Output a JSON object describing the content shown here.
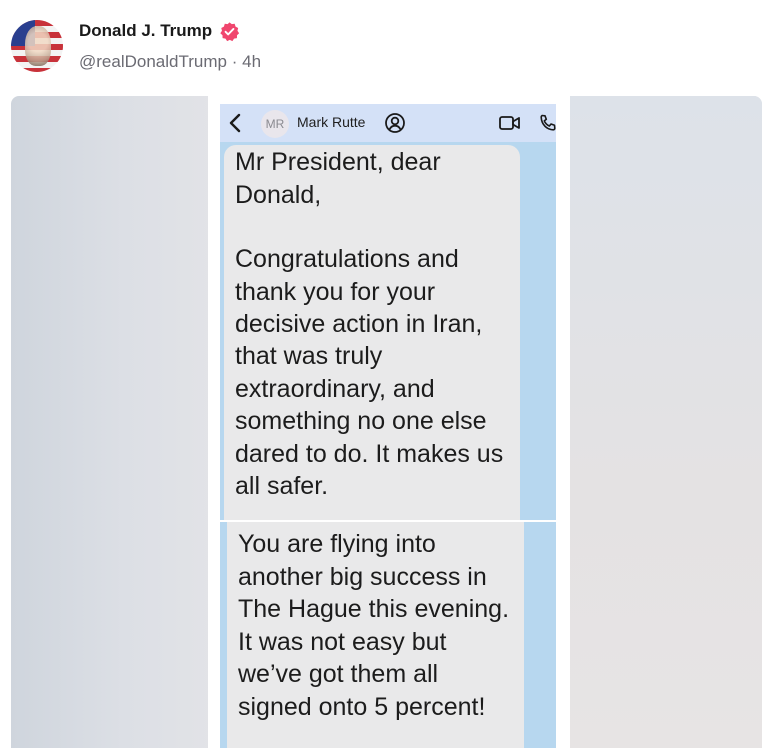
{
  "post": {
    "author_name": "Donald J. Trump",
    "verified_badge_icon": "verified-badge-icon",
    "handle": "@realDonaldTrump",
    "separator": "·",
    "time_ago": "4h",
    "accent_color": "#f0466e"
  },
  "screenshot": {
    "chat_header": {
      "back_icon": "chevron-left-icon",
      "contact_initials": "MR",
      "contact_name": "Mark Rutte",
      "contact_icon": "contact-card-icon",
      "video_icon": "video-call-icon",
      "call_icon": "phone-call-icon"
    },
    "message_1": {
      "lines": [
        "Mr President, dear",
        "Donald,",
        "",
        "Congratulations and",
        "thank you for your",
        "decisive action in Iran,",
        "that was truly",
        "extraordinary, and",
        "something no one else",
        "dared to do.  It makes us",
        "all safer."
      ]
    },
    "message_2": {
      "lines": [
        "You are flying into",
        "another big success in",
        "The Hague this evening.",
        "It was not easy but",
        "we’ve got them all",
        "signed onto 5 percent!"
      ]
    }
  }
}
